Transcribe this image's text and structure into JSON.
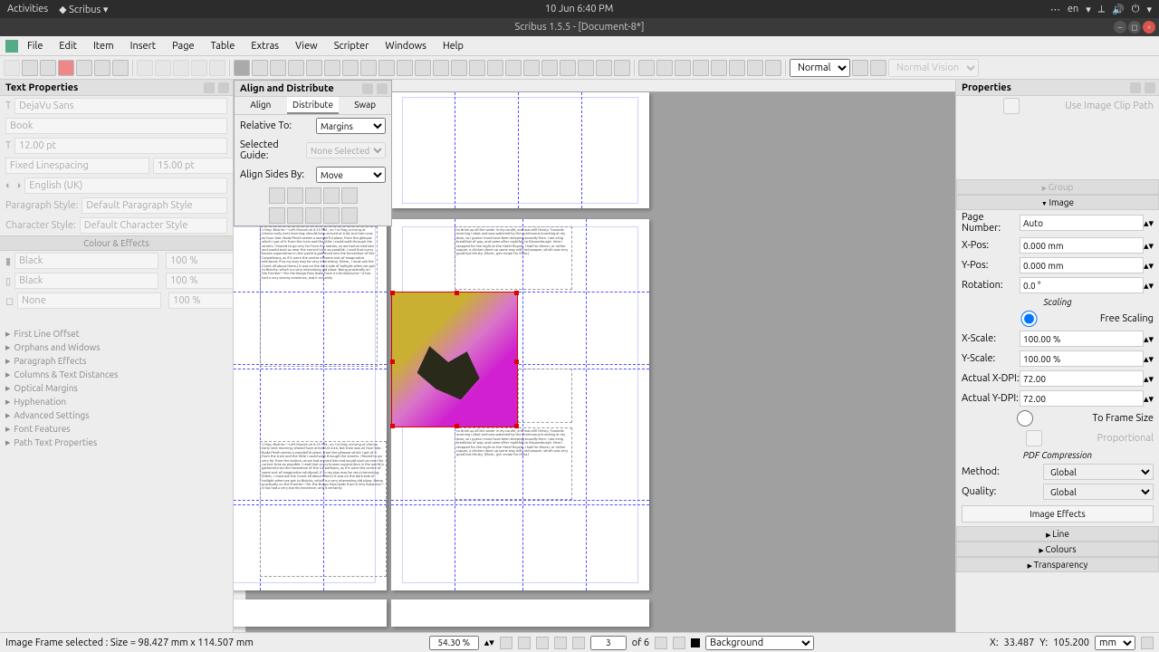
{
  "sysbar": {
    "activities": "Activities",
    "app": "Scribus",
    "datetime": "10 Jun  6:40 PM",
    "lang": "en"
  },
  "titlebar": {
    "title": "Scribus 1.5.5 - [Document-8*]"
  },
  "menu": [
    "File",
    "Edit",
    "Item",
    "Insert",
    "Page",
    "Table",
    "Extras",
    "View",
    "Scripter",
    "Windows",
    "Help"
  ],
  "toolbar": {
    "view_mode": "Normal",
    "vision": "Normal Vision"
  },
  "textprops": {
    "title": "Text Properties",
    "font": "DejaVu Sans",
    "style": "Book",
    "size": "12.00 pt",
    "spacing_mode": "Fixed Linespacing",
    "spacing": "15.00 pt",
    "lang": "English (UK)",
    "para_label": "Paragraph Style:",
    "para_style": "Default Paragraph Style",
    "char_label": "Character Style:",
    "char_style": "Default Character Style",
    "section_colour": "Colour & Effects",
    "fill": "Black",
    "fill_pct": "100 %",
    "stroke": "Black",
    "stroke_pct": "100 %",
    "bg": "None",
    "bg_pct": "100 %",
    "expands": [
      "First Line Offset",
      "Orphans and Widows",
      "Paragraph Effects",
      "Columns & Text Distances",
      "Optical Margins",
      "Hyphenation",
      "Advanced Settings",
      "Font Features",
      "Path Text Properties"
    ]
  },
  "align": {
    "title": "Align and Distribute",
    "tabs": [
      "Align",
      "Distribute",
      "Swap"
    ],
    "active_tab": "Distribute",
    "relative_label": "Relative To:",
    "relative": "Margins",
    "guide_label": "Selected Guide:",
    "guide": "None Selected",
    "sides_label": "Align Sides By:",
    "sides": "Move"
  },
  "props": {
    "title": "Properties",
    "clip": "Use Image Clip Path",
    "group": "Group",
    "image": "Image",
    "page_label": "Page Number:",
    "page": "Auto",
    "xpos_label": "X-Pos:",
    "xpos": "0.000 mm",
    "ypos_label": "Y-Pos:",
    "ypos": "0.000 mm",
    "rot_label": "Rotation:",
    "rot": "0.0 °",
    "scaling": "Scaling",
    "free": "Free Scaling",
    "xscale_label": "X-Scale:",
    "xscale": "100.00 %",
    "yscale_label": "Y-Scale:",
    "yscale": "100.00 %",
    "xdpi_label": "Actual X-DPI:",
    "xdpi": "72.00",
    "ydpi_label": "Actual Y-DPI:",
    "ydpi": "72.00",
    "toframe": "To Frame Size",
    "proportional": "Proportional",
    "pdf": "PDF Compression",
    "method_label": "Method:",
    "method": "Global",
    "quality_label": "Quality:",
    "quality": "Global",
    "effects": "Image Effects",
    "line": "Line",
    "colours": "Colours",
    "transparency": "Transparency"
  },
  "status": {
    "selection": "Image Frame selected  : Size = 98.427 mm x 114.507 mm",
    "zoom": "54.30 %",
    "page": "3",
    "of": "of 6",
    "layer": "Background",
    "x_label": "X:",
    "x": "33.487",
    "y_label": "Y:",
    "y": "105.200",
    "unit": "mm"
  },
  "doc_text": "3 May. Bistritz.—Left Munich at 8:35 P.M., on 1st May, arriving at Vienna early next morning; should have arrived at 6:46, but train was an hour late. Buda-Pesth seems a wonderful place, from the glimpse which I got of it from the train and the little I could walk through the streets. I feared to go very far from the station, as we had arrived late and would start as near the correct time as possible. I read that every known superstition in the world is gathered into the horseshoe of the Carpathians, as if it were the centre of some sort of imaginative whirlpool; if so my stay may be very interesting. (Mem., I must ask the Count all about them.) It was on the dark side of twilight when we got to Bistritz, which is a very interesting old place. Being practically on the frontier—for the Borgo Pass leads from it into Bukovina—it has had a very stormy existence, and it certainly",
  "doc_text2": "to drink up all the water in my carafe, and was still thirsty. Towards morning I slept and was wakened by the continuous knocking at my door, so I guess I must have been sleeping soundly then. I ate a big breakfast of pap, and came after nightfall to Klausenburgh. Here I stopped for the night at the Hotel Royale. I had for dinner, or rather supper, a chicken done up some way with red pepper, which was very good but thirsty. (Mem., get recipe for Mina.)"
}
